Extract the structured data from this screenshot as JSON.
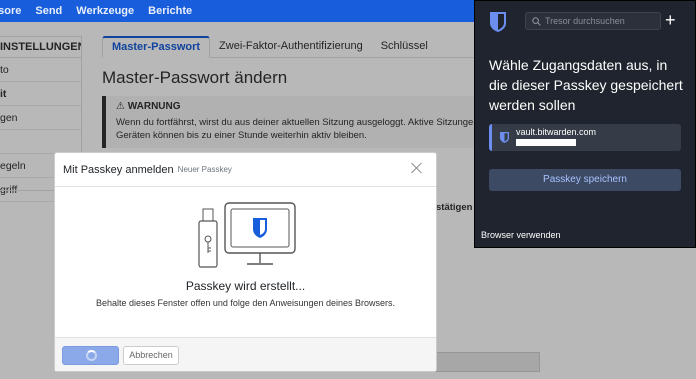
{
  "topnav": {
    "items": [
      "esore",
      "Send",
      "Werkzeuge",
      "Berichte"
    ]
  },
  "sidebar": {
    "heading": "INSTELLUNGEN",
    "items": [
      "to",
      "it",
      "gen",
      "",
      "egeln",
      "griff"
    ]
  },
  "tabs": [
    {
      "label": "Master-Passwort"
    },
    {
      "label": "Zwei-Faktor-Authentifizierung"
    },
    {
      "label": "Schlüssel"
    }
  ],
  "main": {
    "title": "Master-Passwort ändern",
    "warning_title": "WARNUNG",
    "warning_text": "Wenn du fortfährst, wirst du aus deiner aktuellen Sitzung ausgeloggt. Aktive Sitzungen auf a Geräten können bis zu einer Stunde weiterhin aktiv bleiben.",
    "partial_button": "stätigen"
  },
  "modal": {
    "title": "Mit Passkey anmelden",
    "subtitle": "Neuer Passkey",
    "heading": "Passkey wird erstellt...",
    "body": "Behalte dieses Fenster offen und folge den Anweisungen deines Browsers.",
    "cancel_label": "Abbrechen"
  },
  "popup": {
    "search_placeholder": "Tresor durchsuchen",
    "add_label": "+",
    "heading": "Wähle Zugangsdaten aus, in die dieser Passkey gespeichert werden sollen",
    "card_host": "vault.bitwarden.com",
    "save_button": "Passkey speichern",
    "browser_link": "Browser verwenden"
  },
  "colors": {
    "brand": "#175ddc",
    "popup_bg": "#1f242e",
    "popup_accent": "#a7c1ff"
  }
}
